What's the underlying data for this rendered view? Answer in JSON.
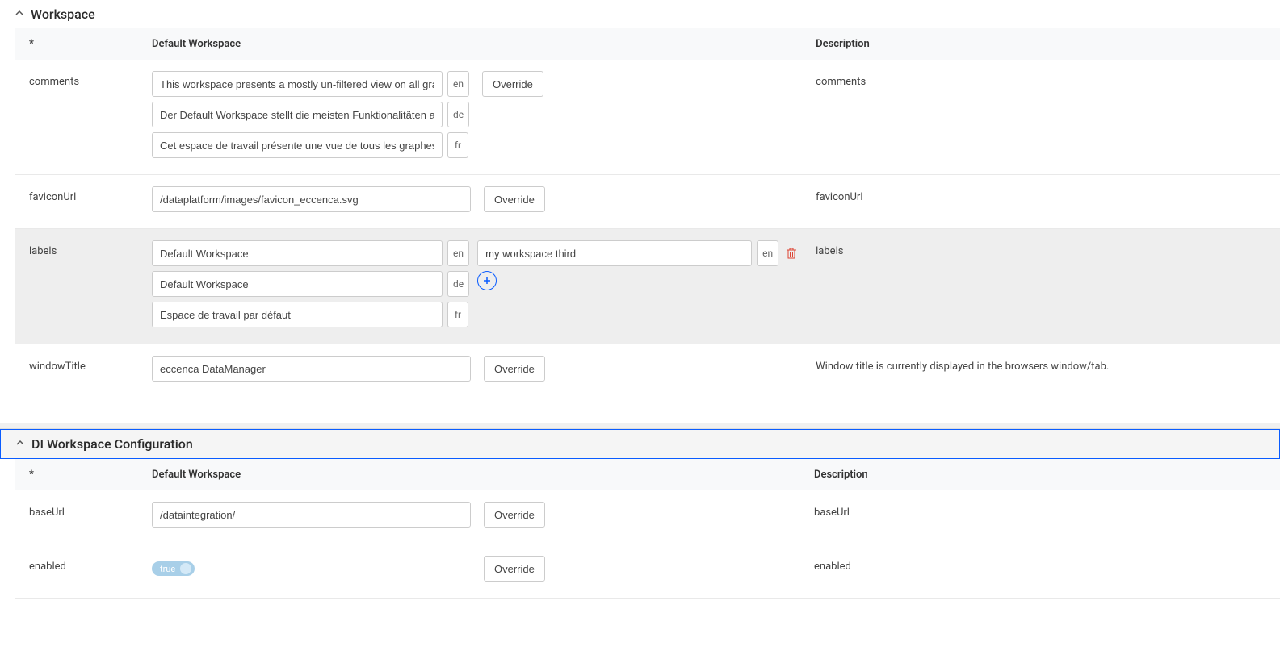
{
  "sections": {
    "workspace": {
      "title": "Workspace",
      "headers": {
        "star": "*",
        "default": "Default Workspace",
        "desc": "Description"
      },
      "rows": {
        "comments": {
          "key": "comments",
          "entries": [
            {
              "value": "This workspace presents a mostly un-filtered view on all graphs",
              "lang": "en"
            },
            {
              "value": "Der Default Workspace stellt die meisten Funktionalitäten a",
              "lang": "de"
            },
            {
              "value": "Cet espace de travail présente une vue de tous les graphes",
              "lang": "fr"
            }
          ],
          "override": "Override",
          "desc": "comments"
        },
        "faviconUrl": {
          "key": "faviconUrl",
          "value": "/dataplatform/images/favicon_eccenca.svg",
          "override": "Override",
          "desc": "faviconUrl"
        },
        "labels": {
          "key": "labels",
          "defaults": [
            {
              "value": "Default Workspace",
              "lang": "en"
            },
            {
              "value": "Default Workspace",
              "lang": "de"
            },
            {
              "value": "Espace de travail par défaut",
              "lang": "fr"
            }
          ],
          "overrides": [
            {
              "value": "my workspace third",
              "lang": "en"
            }
          ],
          "desc": "labels"
        },
        "windowTitle": {
          "key": "windowTitle",
          "value": "eccenca DataManager",
          "override": "Override",
          "desc": "Window title is currently displayed in the browsers window/tab."
        }
      }
    },
    "diWorkspace": {
      "title": "DI Workspace Configuration",
      "headers": {
        "star": "*",
        "default": "Default Workspace",
        "desc": "Description"
      },
      "rows": {
        "baseUrl": {
          "key": "baseUrl",
          "value": "/dataintegration/",
          "override": "Override",
          "desc": "baseUrl"
        },
        "enabled": {
          "key": "enabled",
          "value": "true",
          "override": "Override",
          "desc": "enabled"
        }
      }
    }
  }
}
